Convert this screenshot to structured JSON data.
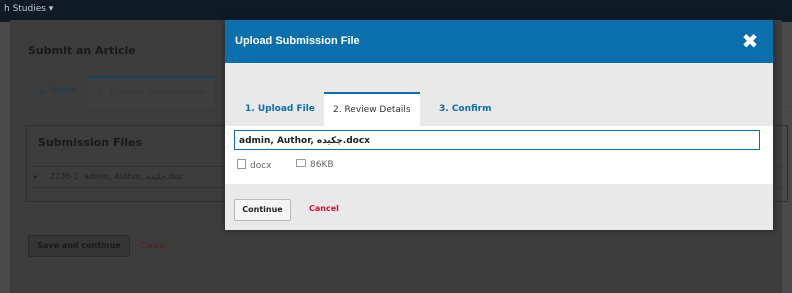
{
  "site": {
    "label": "h Studies ▾"
  },
  "background": {
    "page_title": "Submit an Article",
    "tabs": [
      {
        "label": "1. Start"
      },
      {
        "label": "2. Upload Submission"
      }
    ],
    "files_title": "Submission Files",
    "file_row": {
      "expander": "▸",
      "id": "2235-1",
      "name": "admin, Author, جکیده.doc"
    },
    "save_label": "Save and continue",
    "cancel_label": "Cancel"
  },
  "modal": {
    "title": "Upload Submission File",
    "close_icon": "close-icon",
    "tabs": [
      {
        "label": "1. Upload File"
      },
      {
        "label": "2. Review Details"
      },
      {
        "label": "3. Confirm"
      }
    ],
    "file_name_value": "admin, Author, چکیده.docx",
    "file_type": "docx",
    "file_size": "86KB",
    "continue_label": "Continue",
    "cancel_label": "Cancel"
  }
}
